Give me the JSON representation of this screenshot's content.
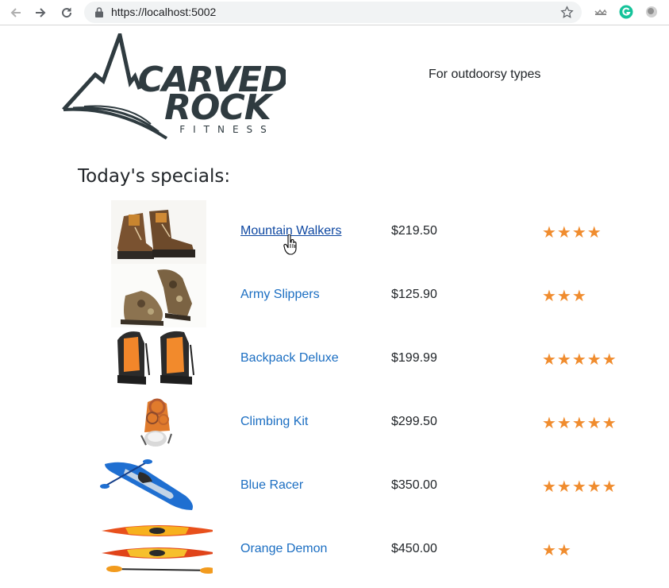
{
  "browser": {
    "url": "https://localhost:5002",
    "icons": {
      "back": "arrow-left-icon",
      "forward": "arrow-right-icon",
      "reload": "reload-icon",
      "lock": "lock-icon",
      "bookmark": "star-icon"
    }
  },
  "header": {
    "logo_name": "Carved Rock Fitness",
    "logo_line1": "CARVED",
    "logo_line2": "ROCK",
    "logo_line3": "FITNESS",
    "tagline": "For outdoorsy types"
  },
  "main": {
    "heading": "Today's specials:",
    "products": [
      {
        "name": "Mountain Walkers",
        "price": "$219.50",
        "stars": "★★★★",
        "rating": 4,
        "image": "hiking-boots"
      },
      {
        "name": "Army Slippers",
        "price": "$125.90",
        "stars": "★★★",
        "rating": 3,
        "image": "camo-sandals"
      },
      {
        "name": "Backpack Deluxe",
        "price": "$199.99",
        "stars": "★★★★★",
        "rating": 5,
        "image": "orange-backpacks"
      },
      {
        "name": "Climbing Kit",
        "price": "$299.50",
        "stars": "★★★★★",
        "rating": 5,
        "image": "climbing-gear"
      },
      {
        "name": "Blue Racer",
        "price": "$350.00",
        "stars": "★★★★★",
        "rating": 5,
        "image": "blue-kayak"
      },
      {
        "name": "Orange Demon",
        "price": "$450.00",
        "stars": "★★",
        "rating": 2,
        "image": "orange-kayaks"
      }
    ]
  },
  "colors": {
    "link": "#1b6ec2",
    "star": "#f08c2e",
    "logo": "#2f3b40"
  }
}
